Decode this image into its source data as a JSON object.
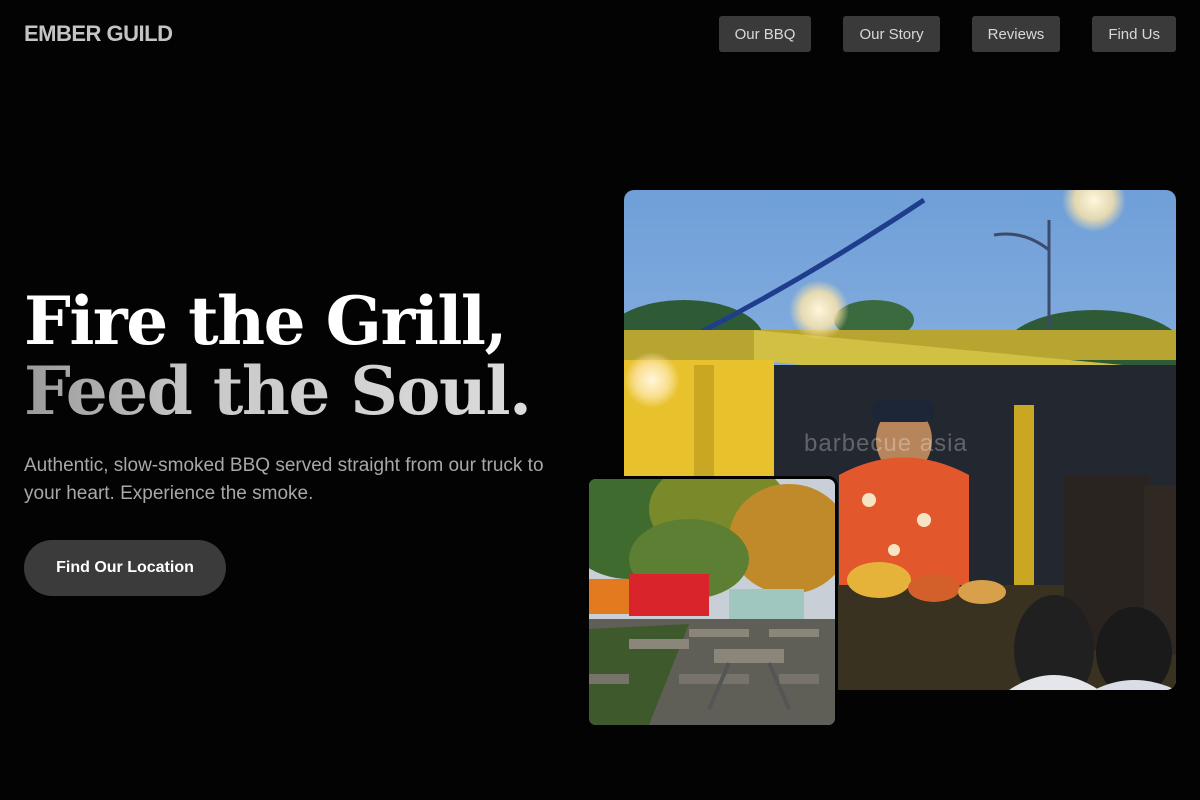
{
  "brand": {
    "name": "EMBER GUILD"
  },
  "nav": {
    "items": [
      {
        "label": "Our BBQ"
      },
      {
        "label": "Our Story"
      },
      {
        "label": "Reviews"
      },
      {
        "label": "Find Us"
      }
    ]
  },
  "hero": {
    "headline_line1": "Fire the Grill,",
    "headline_line2": "Feed the Soul.",
    "subtitle": "Authentic, slow-smoked BBQ served straight from our truck to your heart. Experience the smoke.",
    "cta_label": "Find Our Location"
  },
  "photos": {
    "main": {
      "watermark": "barbecue asia"
    }
  },
  "colors": {
    "background": "#030303",
    "nav_button": "#3a3a3a",
    "cta_button": "#3b3b3b",
    "subtitle_text": "#a8a8a8",
    "truck_yellow": "#e7c22d"
  }
}
